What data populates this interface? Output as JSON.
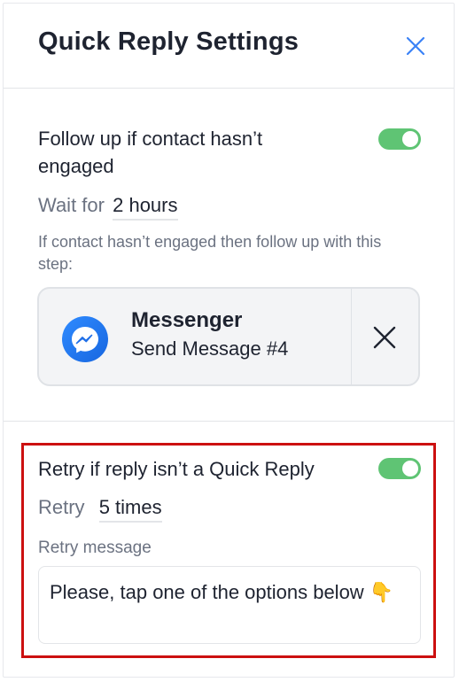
{
  "panel": {
    "title": "Quick Reply Settings"
  },
  "follow_up": {
    "label": "Follow up if contact hasn’t engaged",
    "toggle_on": true,
    "wait_label": "Wait for",
    "wait_value": "2 hours",
    "hint": "If contact hasn’t engaged then follow up with this step:",
    "step": {
      "icon": "messenger-icon",
      "title": "Messenger",
      "subtitle": "Send Message #4"
    }
  },
  "retry": {
    "label": "Retry if reply isn’t a Quick Reply",
    "toggle_on": true,
    "retry_label": "Retry",
    "retry_value": "5 times",
    "message_label": "Retry message",
    "message_value": "Please, tap one of the options below 👇"
  },
  "colors": {
    "toggle_on": "#5fc474",
    "accent_blue": "#1a73e8",
    "highlight_border": "#cc1010"
  }
}
